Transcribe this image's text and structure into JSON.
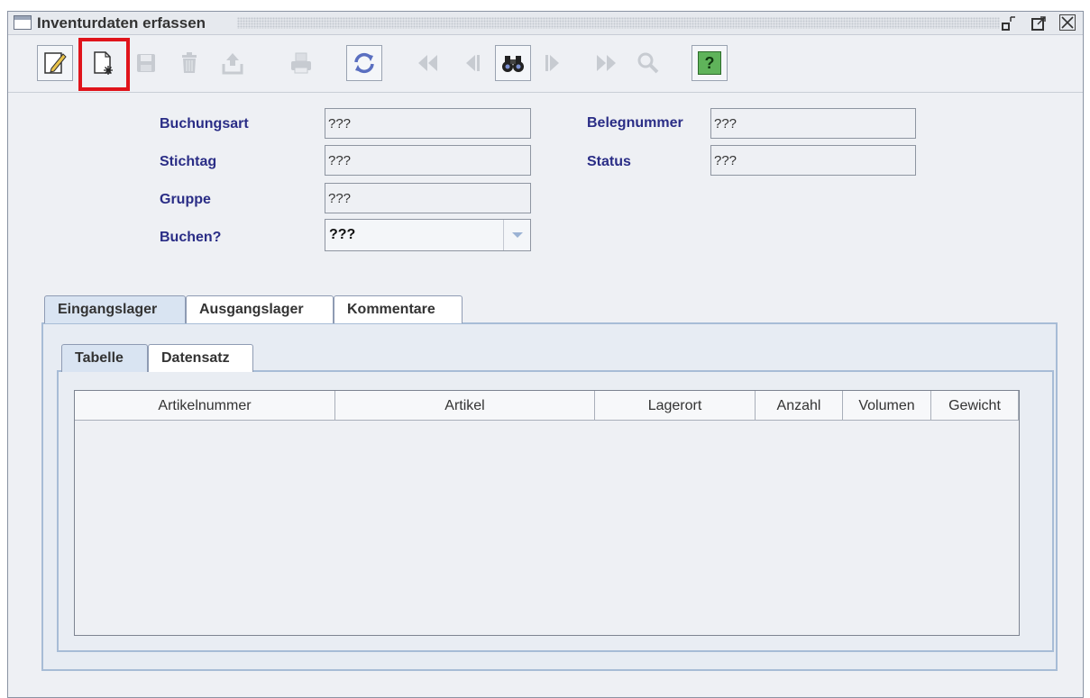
{
  "window": {
    "title": "Inventurdaten erfassen"
  },
  "toolbar": {
    "buttons": [
      {
        "name": "edit-icon"
      },
      {
        "name": "new-record-icon"
      },
      {
        "name": "save-icon"
      },
      {
        "name": "delete-icon"
      },
      {
        "name": "export-icon"
      },
      {
        "name": "print-icon"
      },
      {
        "name": "refresh-icon"
      },
      {
        "name": "first-icon"
      },
      {
        "name": "previous-icon"
      },
      {
        "name": "find-icon"
      },
      {
        "name": "next-icon"
      },
      {
        "name": "last-icon"
      },
      {
        "name": "search-icon"
      },
      {
        "name": "help-icon"
      }
    ],
    "help_label": "?"
  },
  "form": {
    "buchungsart_label": "Buchungsart",
    "buchungsart_value": "???",
    "stichtag_label": "Stichtag",
    "stichtag_value": "???",
    "gruppe_label": "Gruppe",
    "gruppe_value": "???",
    "buchen_label": "Buchen?",
    "buchen_value": "???",
    "belegnummer_label": "Belegnummer",
    "belegnummer_value": "???",
    "status_label": "Status",
    "status_value": "???"
  },
  "tabs": [
    "Eingangslager",
    "Ausgangslager",
    "Kommentare"
  ],
  "subtabs": [
    "Tabelle",
    "Datensatz"
  ],
  "table": {
    "columns": [
      "Artikelnummer",
      "Artikel",
      "Lagerort",
      "Anzahl",
      "Volumen",
      "Gewicht"
    ],
    "rows": []
  },
  "colors": {
    "label": "#2a2d86",
    "highlight": "#e0141b",
    "tab_active": "#d9e4f2"
  }
}
